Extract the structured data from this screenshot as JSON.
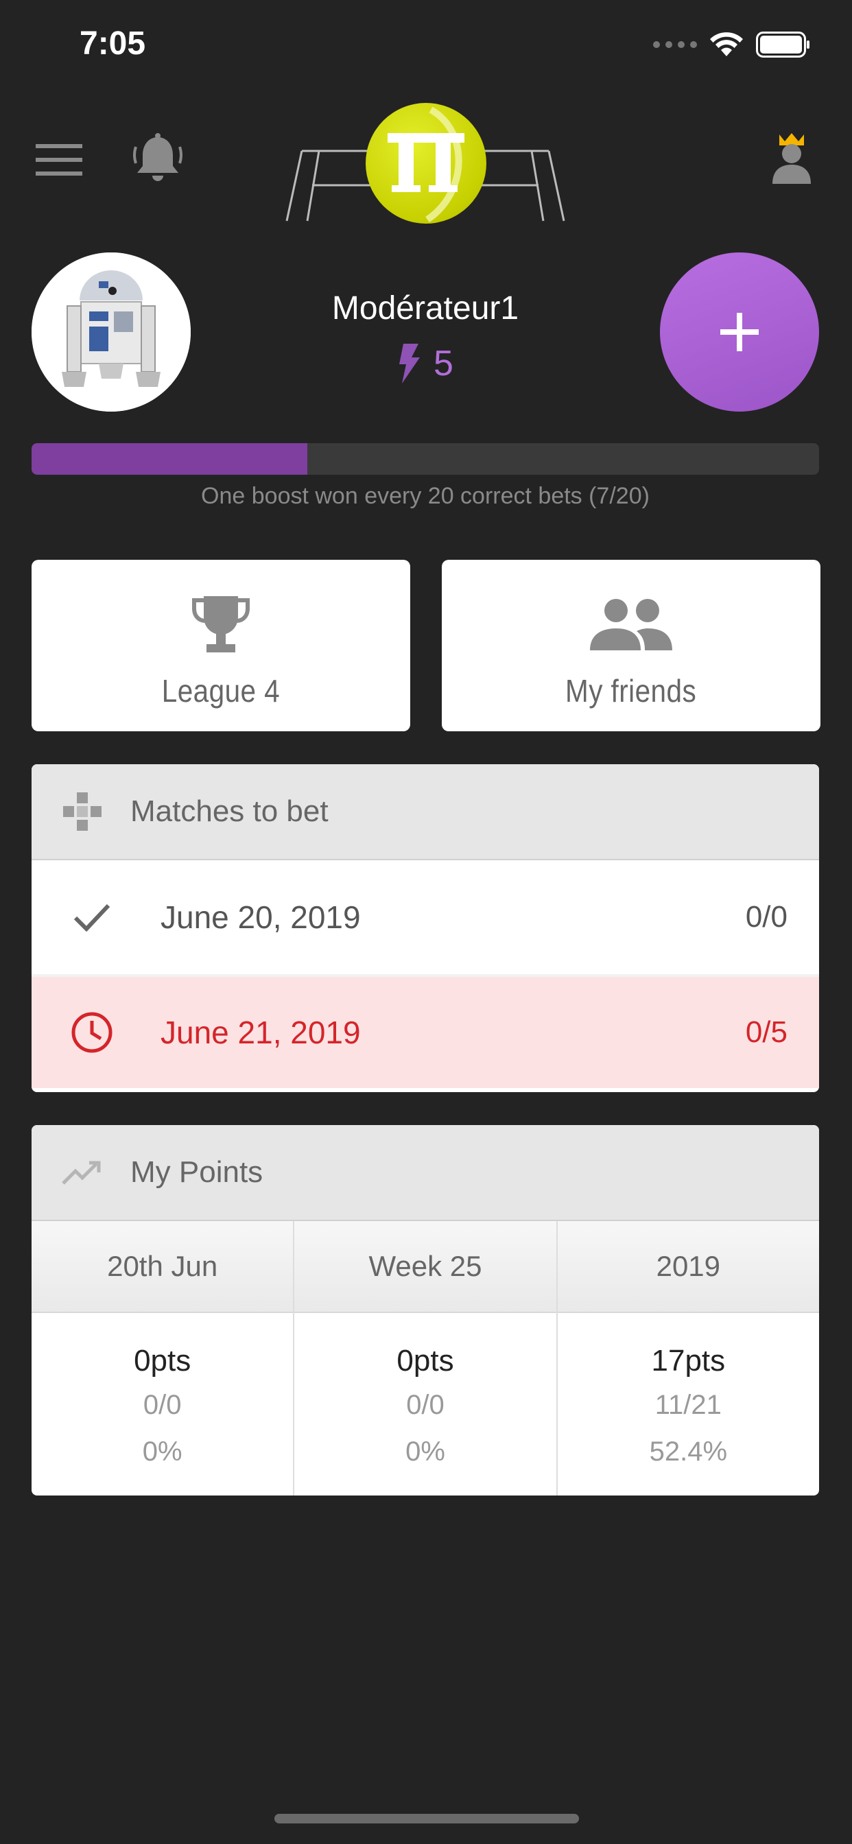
{
  "status_bar": {
    "time": "7:05"
  },
  "profile": {
    "username": "Modérateur1",
    "boosts": "5",
    "add_label": "+"
  },
  "progress": {
    "fraction": 0.35,
    "caption": "One boost won every 20 correct bets (7/20)"
  },
  "cards": {
    "league_label": "League 4",
    "friends_label": "My friends"
  },
  "matches": {
    "title": "Matches to bet",
    "rows": [
      {
        "date": "June 20, 2019",
        "score": "0/0",
        "state": "done"
      },
      {
        "date": "June 21, 2019",
        "score": "0/5",
        "state": "pending"
      }
    ]
  },
  "points": {
    "title": "My Points",
    "columns": [
      {
        "label": "20th Jun",
        "pts": "0pts",
        "ratio": "0/0",
        "percent": "0%"
      },
      {
        "label": "Week 25",
        "pts": "0pts",
        "ratio": "0/0",
        "percent": "0%"
      },
      {
        "label": "2019",
        "pts": "17pts",
        "ratio": "11/21",
        "percent": "52.4%"
      }
    ]
  },
  "colors": {
    "background": "#232323",
    "accent_purple": "#a45fd2",
    "progress_fill": "#7e3f9e",
    "ball_yellow": "#d4dc14",
    "alert_red": "#d4252a",
    "alert_bg": "#fde2e3"
  },
  "icons": [
    "menu-icon",
    "bell-icon",
    "crown-user-icon",
    "bolt-icon",
    "plus-icon",
    "trophy-icon",
    "group-icon",
    "gamepad-icon",
    "check-icon",
    "clock-icon",
    "trending-icon",
    "wifi-icon",
    "battery-icon"
  ]
}
